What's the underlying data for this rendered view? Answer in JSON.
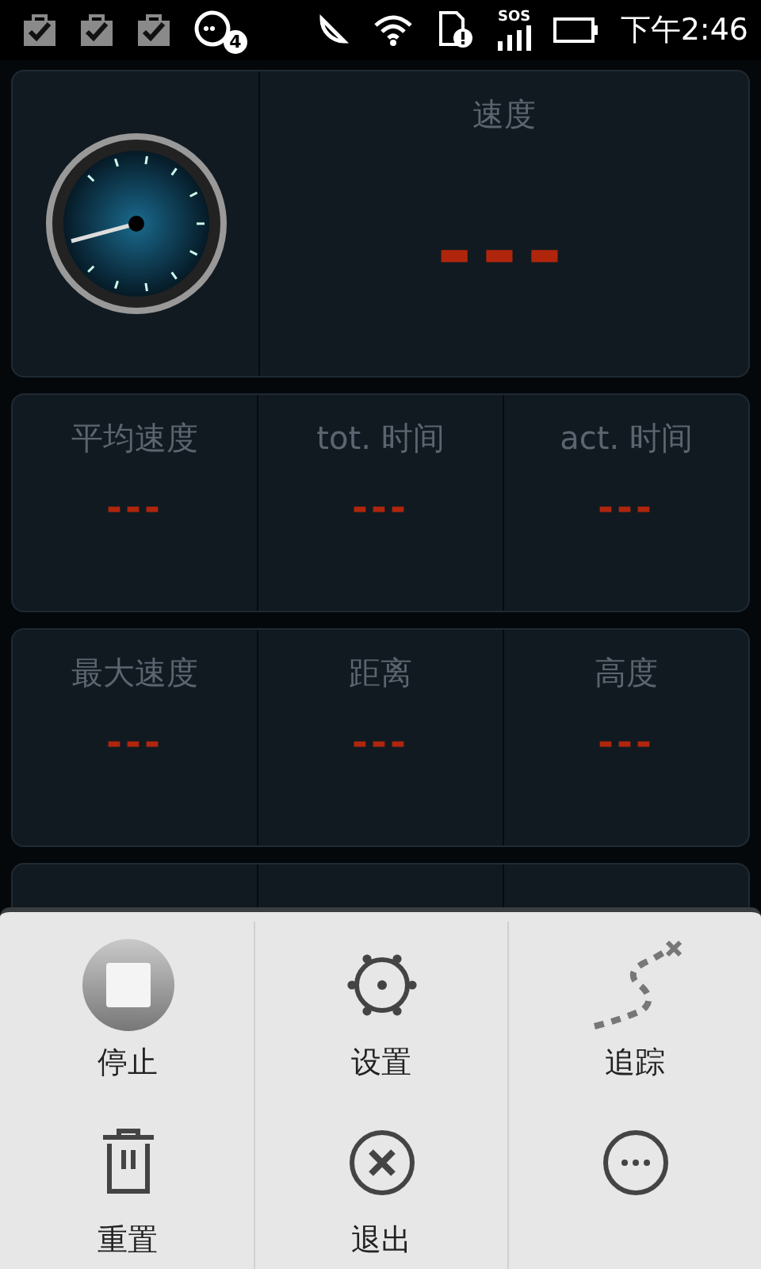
{
  "status_bar": {
    "notification_count": "4",
    "signal_label": "SOS",
    "time": "下午2:46"
  },
  "speed_card": {
    "label": "速度",
    "value": "---"
  },
  "stat_rows": [
    [
      {
        "label": "平均速度",
        "value": "---"
      },
      {
        "label": "tot. 时间",
        "value": "---"
      },
      {
        "label": "act. 时间",
        "value": "---"
      }
    ],
    [
      {
        "label": "最大速度",
        "value": "---"
      },
      {
        "label": "距离",
        "value": "---"
      },
      {
        "label": "高度",
        "value": "---"
      }
    ]
  ],
  "menu": [
    {
      "kind": "stop",
      "label": "停止"
    },
    {
      "kind": "gear",
      "label": "设置"
    },
    {
      "kind": "track",
      "label": "追踪"
    },
    {
      "kind": "trash",
      "label": "重置"
    },
    {
      "kind": "close",
      "label": "退出"
    },
    {
      "kind": "more"
    }
  ]
}
